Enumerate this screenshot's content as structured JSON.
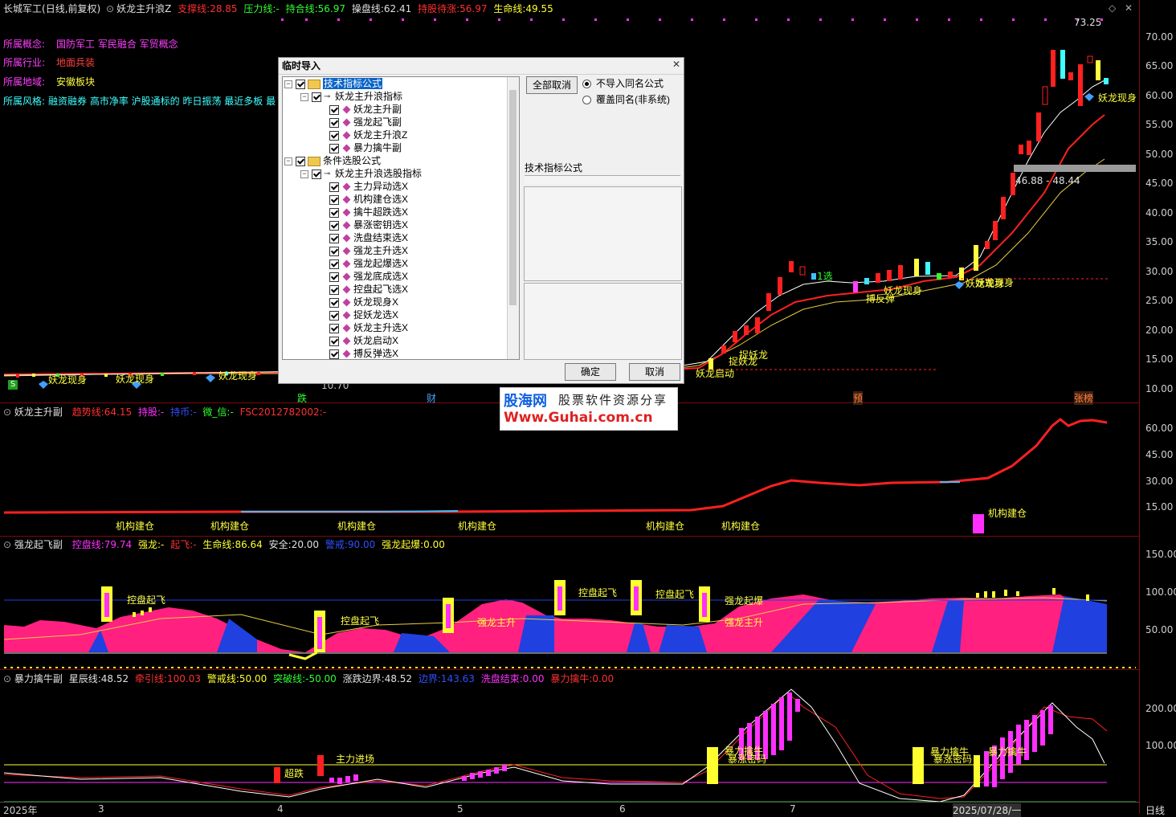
{
  "header": {
    "stock": "长城军工",
    "period": "(日线,前复权)",
    "indicator": "妖龙主升浪Z",
    "support_label": "支撑线:",
    "support_val": "28.85",
    "pressure_label": "压力线:",
    "pressure_val": "-",
    "hold_label": "持合线:",
    "hold_val": "56.97",
    "op_label": "操盘线:",
    "op_val": "62.41",
    "wait_label": "持股待涨:",
    "wait_val": "56.97",
    "life_label": "生命线:",
    "life_val": "49.55"
  },
  "info": {
    "concept_label": "所属概念:",
    "concept_val": "国防军工  军民融合  军贸概念",
    "industry_label": "所属行业:",
    "industry_val": "地面兵装",
    "region_label": "所属地域:",
    "region_val": "安徽板块",
    "style_label": "所属风格:",
    "style_val": "融资融券  高市净率  沪股通标的  昨日振荡  最近多板  最"
  },
  "main_chart": {
    "high_label": "73.25",
    "range_label": "46.88 - 48.44",
    "low_label": "10.70",
    "annotations": [
      "妖龙现身",
      "妖龙现身",
      "妖龙现身",
      "妖龙启动",
      "捉妖龙",
      "捉妖龙",
      "妖龙现身",
      "搏反弹",
      "妖龙现身",
      "妖龙现身",
      "妖龙现身",
      "1选"
    ],
    "markers": [
      "跌",
      "财",
      "预",
      "张榜",
      "S"
    ],
    "y_ticks": [
      "70.00",
      "65.00",
      "60.00",
      "55.00",
      "50.00",
      "45.00",
      "40.00",
      "35.00",
      "30.00",
      "25.00",
      "20.00",
      "15.00",
      "10.00"
    ]
  },
  "pane2": {
    "name": "妖龙主升副",
    "trend_label": "趋势线:",
    "trend_val": "64.15",
    "hold_label": "持股:",
    "hold_val": "-",
    "retail_label": "持币:",
    "retail_val": "-",
    "wechat_label": "微_信:",
    "wechat_val": "-",
    "code_label": "FSC2012782002:",
    "code_val": "-",
    "annotation": "机构建仓",
    "y_ticks": [
      "60.00",
      "45.00",
      "30.00",
      "15.00"
    ]
  },
  "pane3": {
    "name": "强龙起飞副",
    "ctrl_label": "控盘线:",
    "ctrl_val": "79.74",
    "dragon_label": "强龙:",
    "dragon_val": "-",
    "fly_label": "起飞:",
    "fly_val": "-",
    "life_label": "生命线:",
    "life_val": "86.64",
    "safe_label": "安全:",
    "safe_val": "20.00",
    "danger_label": "警戒:",
    "danger_val": "90.00",
    "burst_label": "强龙起爆:",
    "burst_val": "0.00",
    "annotations": [
      "控盘起飞",
      "控盘起飞",
      "控盘起飞",
      "控盘起飞",
      "强龙主升",
      "强龙主升",
      "强龙起爆"
    ],
    "y_ticks": [
      "150.00",
      "100.00",
      "50.00"
    ]
  },
  "pane4": {
    "name": "暴力擒牛副",
    "star_label": "星辰线:",
    "star_val": "48.52",
    "lead_label": "牵引线:",
    "lead_val": "100.03",
    "warn_label": "警戒线:",
    "warn_val": "50.00",
    "break_label": "突破线:",
    "break_val": "-50.00",
    "bound_label": "涨跌边界:",
    "bound_val": "48.52",
    "edge_label": "边界:",
    "edge_val": "143.63",
    "wash_label": "洗盘结束:",
    "wash_val": "0.00",
    "bull_label": "暴力擒牛:",
    "bull_val": "0.00",
    "annotations": [
      "超跌",
      "主力进场",
      "暴力擒牛",
      "暴涨密码",
      "暴力擒牛",
      "暴涨密码",
      "暴力擒牛"
    ],
    "y_ticks": [
      "200.00",
      "100.00"
    ]
  },
  "x_axis": [
    "2025年",
    "3",
    "4",
    "5",
    "6",
    "7",
    "2025/07/28/一"
  ],
  "period_button": "日线",
  "dialog": {
    "title": "临时导入",
    "group1": "技术指标公式",
    "group1_sub": "妖龙主升浪指标",
    "group1_items": [
      "妖龙主升副",
      "强龙起飞副",
      "妖龙主升浪Z",
      "暴力擒牛副"
    ],
    "group2": "条件选股公式",
    "group2_sub": "妖龙主升浪选股指标",
    "group2_items": [
      "主力异动选X",
      "机构建仓选X",
      "擒牛超跌选X",
      "暴涨密钥选X",
      "洗盘结束选X",
      "强龙主升选X",
      "强龙起爆选X",
      "强龙底成选X",
      "控盘起飞选X",
      "妖龙现身X",
      "捉妖龙选X",
      "妖龙主升选X",
      "妖龙启动X",
      "搏反弹选X"
    ],
    "cancel_all": "全部取消",
    "radio1": "不导入同名公式",
    "radio2": "覆盖同名(非系统)",
    "type_label": "技术指标公式",
    "ok": "确定",
    "cancel": "取消"
  },
  "watermark": {
    "logo": "股海网",
    "slogan": "股票软件资源分享",
    "url": "Www.Guhai.com.cn"
  }
}
